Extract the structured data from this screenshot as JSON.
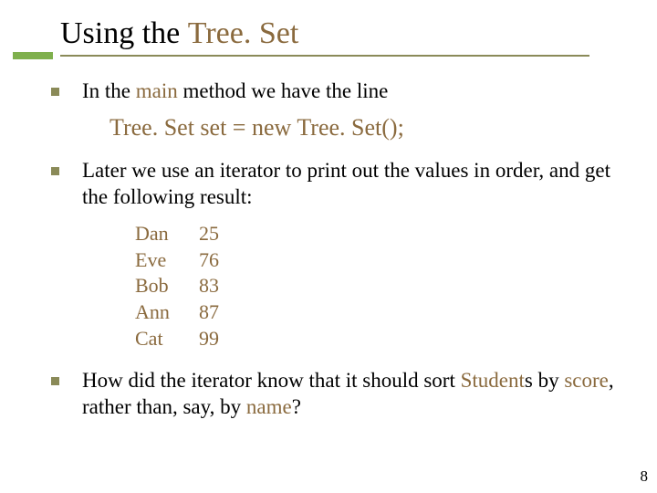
{
  "title": {
    "prefix": "Using the ",
    "code": "Tree. Set"
  },
  "bullets": {
    "b1": {
      "pre": "In the ",
      "code1": "main",
      "post": " method we have the line"
    },
    "codeLine": "Tree. Set set = new Tree. Set();",
    "b2": "Later we use an iterator to print out the values in order, and get the following result:",
    "b3": {
      "t1": "How did the iterator know that it should sort ",
      "c1": "Student",
      "t2": "s by ",
      "c2": "score",
      "t3": ", rather than, say, by ",
      "c3": "name",
      "t4": "?"
    }
  },
  "output": [
    {
      "name": "Dan",
      "score": "25"
    },
    {
      "name": "Eve",
      "score": "76"
    },
    {
      "name": "Bob",
      "score": "83"
    },
    {
      "name": "Ann",
      "score": "87"
    },
    {
      "name": "Cat",
      "score": "99"
    }
  ],
  "pageNumber": "8"
}
